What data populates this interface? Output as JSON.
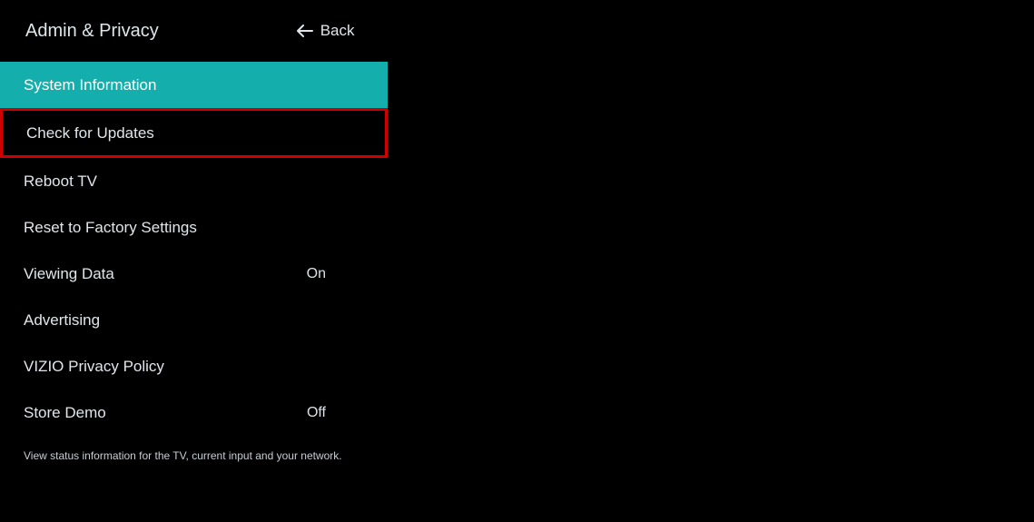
{
  "header": {
    "title": "Admin & Privacy",
    "back_label": "Back"
  },
  "menu": {
    "items": [
      {
        "label": "System Information",
        "value": "",
        "selected": true,
        "highlighted": false
      },
      {
        "label": "Check for Updates",
        "value": "",
        "selected": false,
        "highlighted": true
      },
      {
        "label": "Reboot TV",
        "value": "",
        "selected": false,
        "highlighted": false
      },
      {
        "label": "Reset to Factory Settings",
        "value": "",
        "selected": false,
        "highlighted": false
      },
      {
        "label": "Viewing Data",
        "value": "On",
        "selected": false,
        "highlighted": false
      },
      {
        "label": "Advertising",
        "value": "",
        "selected": false,
        "highlighted": false
      },
      {
        "label": "VIZIO Privacy Policy",
        "value": "",
        "selected": false,
        "highlighted": false
      },
      {
        "label": "Store Demo",
        "value": "Off",
        "selected": false,
        "highlighted": false
      }
    ]
  },
  "footer": {
    "description": "View status information for the TV, current input and your network."
  }
}
